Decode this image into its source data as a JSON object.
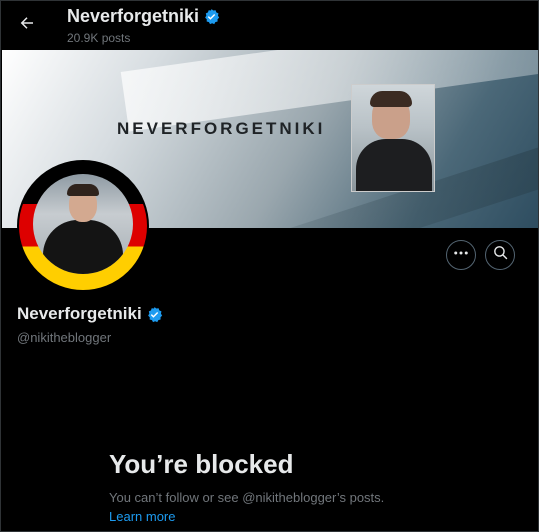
{
  "header": {
    "back_icon": "arrow-left-icon",
    "title": "Neverforgetniki",
    "verified_icon": "verified-badge-icon",
    "post_count": "20.9K posts"
  },
  "banner": {
    "text": "NEVERFORGETNIKI"
  },
  "actions": {
    "more_icon": "more-horizontal-icon",
    "search_icon": "search-icon"
  },
  "profile": {
    "display_name": "Neverforgetniki",
    "handle": "@nikitheblogger"
  },
  "blocked": {
    "title": "You’re blocked",
    "message": "You can’t follow or see @nikitheblogger’s posts.",
    "link": "Learn more"
  },
  "colors": {
    "background": "#000000",
    "text_primary": "#e7e9ea",
    "text_secondary": "#71767b",
    "accent": "#1d9bf0",
    "verified": "#1d9bf0"
  }
}
